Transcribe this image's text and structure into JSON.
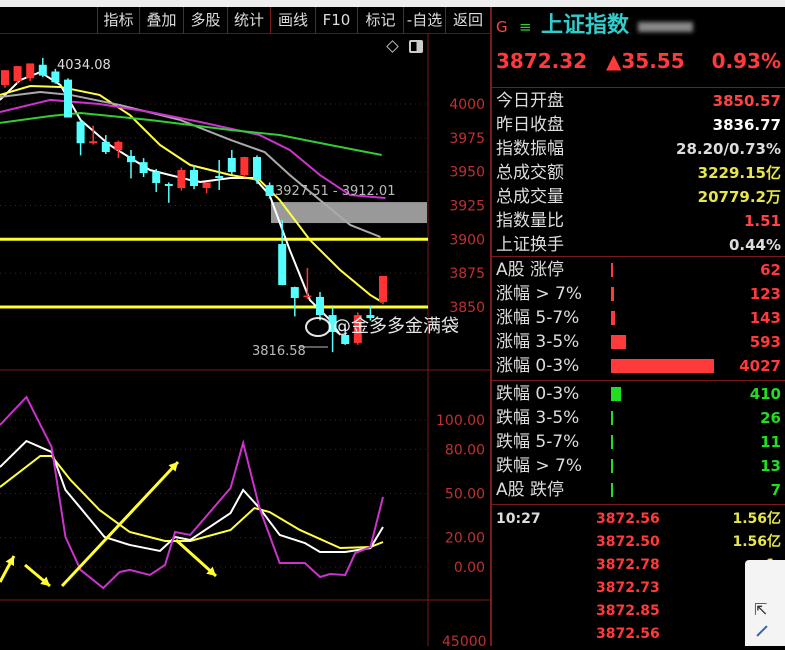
{
  "toolbar": {
    "items": [
      "指标",
      "叠加",
      "多股",
      "统计",
      "画线",
      "F10",
      "标记",
      "-自选",
      "返回"
    ]
  },
  "chart": {
    "price_axis": [
      "4000",
      "3975",
      "3950",
      "3925",
      "3900",
      "3875",
      "3850"
    ],
    "price_axis_values": [
      4000,
      3975,
      3950,
      3925,
      3900,
      3875,
      3850
    ],
    "indicator_axis": [
      "100.00",
      "80.00",
      "50.00",
      "20.00",
      "0.00"
    ],
    "indicator_axis_values": [
      100,
      80,
      50,
      20,
      0
    ],
    "bottom_axis_label": "45000",
    "high_label": "4034.08",
    "low_label": "3816.58",
    "range_label": "3927.51 - 3912.01",
    "range_band": [
      3912.01,
      3927.51
    ],
    "support_lines": [
      3900,
      3850
    ],
    "watermark": "@金多多金满袋",
    "colors": {
      "up": "#ff3333",
      "down": "#55ffff",
      "ma5": "#ffffff",
      "ma10": "#ffff44",
      "ma20": "#aaaaaa",
      "ma30": "#cc33cc",
      "ma60": "#33cc33",
      "k": "#ffffff",
      "d": "#ffff44",
      "j": "#cc33cc"
    }
  },
  "chart_data": {
    "type": "candlestick",
    "ylim": [
      3810,
      4040
    ],
    "candles": [
      {
        "o": 4014,
        "h": 4025,
        "l": 4012,
        "c": 4025
      },
      {
        "o": 4017,
        "h": 4028,
        "l": 4015,
        "c": 4028
      },
      {
        "o": 4019,
        "h": 4030,
        "l": 4017,
        "c": 4030
      },
      {
        "o": 4029,
        "h": 4034.08,
        "l": 4020,
        "c": 4021
      },
      {
        "o": 4024,
        "h": 4026,
        "l": 4015,
        "c": 4016
      },
      {
        "o": 4018,
        "h": 4019,
        "l": 3990,
        "c": 3990
      },
      {
        "o": 3987,
        "h": 3988,
        "l": 3962,
        "c": 3971
      },
      {
        "o": 3971,
        "h": 3984,
        "l": 3970,
        "c": 3972.5
      },
      {
        "o": 3972,
        "h": 3977,
        "l": 3963,
        "c": 3964.5
      },
      {
        "o": 3966,
        "h": 3973,
        "l": 3960,
        "c": 3972
      },
      {
        "o": 3961.6,
        "h": 3966,
        "l": 3945,
        "c": 3957
      },
      {
        "o": 3957,
        "h": 3960,
        "l": 3946,
        "c": 3949
      },
      {
        "o": 3949.7,
        "h": 3952,
        "l": 3935,
        "c": 3941.6
      },
      {
        "o": 3940.9,
        "h": 3942,
        "l": 3927,
        "c": 3939.4
      },
      {
        "o": 3937.9,
        "h": 3953,
        "l": 3936,
        "c": 3951.2
      },
      {
        "o": 3951.2,
        "h": 3955,
        "l": 3937,
        "c": 3939.4
      },
      {
        "o": 3937.9,
        "h": 3942,
        "l": 3934,
        "c": 3942
      },
      {
        "o": 3946.8,
        "h": 3958.6,
        "l": 3936.4,
        "c": 3945.3
      },
      {
        "o": 3960.1,
        "h": 3966,
        "l": 3948,
        "c": 3949.7
      },
      {
        "o": 3947.5,
        "h": 3961,
        "l": 3946,
        "c": 3960.8
      },
      {
        "o": 3960.8,
        "h": 3962,
        "l": 3941,
        "c": 3943.8
      },
      {
        "o": 3940,
        "h": 3942,
        "l": 3930,
        "c": 3932
      },
      {
        "o": 3896.5,
        "h": 3914.3,
        "l": 3866,
        "c": 3866.2
      },
      {
        "o": 3864.7,
        "h": 3865,
        "l": 3843,
        "c": 3856.6
      },
      {
        "o": 3857.4,
        "h": 3878.8,
        "l": 3856,
        "c": 3858.4
      },
      {
        "o": 3857.4,
        "h": 3861,
        "l": 3840,
        "c": 3844
      },
      {
        "o": 3844,
        "h": 3850,
        "l": 3816.58,
        "c": 3831.5
      },
      {
        "o": 3829.3,
        "h": 3834,
        "l": 3822,
        "c": 3822.6
      },
      {
        "o": 3823.4,
        "h": 3846,
        "l": 3822,
        "c": 3844
      },
      {
        "o": 3844,
        "h": 3851,
        "l": 3840,
        "c": 3841.8
      },
      {
        "o": 3853.7,
        "h": 3873,
        "l": 3852,
        "c": 3872.9
      }
    ],
    "ma": [
      {
        "name": "MA5",
        "color": "ma5",
        "points": [
          [
            -0.4,
            4003
          ],
          [
            1.2,
            4017.7
          ],
          [
            2.8,
            4023.6
          ],
          [
            4.4,
            4014
          ],
          [
            6,
            3988.2
          ],
          [
            8.3,
            3969.7
          ],
          [
            11.5,
            3951.2
          ],
          [
            14.7,
            3943.8
          ],
          [
            15.5,
            3942.4
          ],
          [
            17.9,
            3945.3
          ],
          [
            19.8,
            3945.3
          ],
          [
            21,
            3932.7
          ],
          [
            22.6,
            3892.1
          ],
          [
            24.2,
            3855.1
          ],
          [
            25.8,
            3840.3
          ],
          [
            26.6,
            3829.3
          ]
        ]
      },
      {
        "name": "MA10",
        "color": "ma10",
        "points": [
          [
            -0.4,
            4006.7
          ],
          [
            2,
            4013.3
          ],
          [
            4.4,
            4012.6
          ],
          [
            7.5,
            4006.7
          ],
          [
            9.9,
            3991.9
          ],
          [
            12.3,
            3969.7
          ],
          [
            14.7,
            3954.9
          ],
          [
            17.9,
            3947.5
          ],
          [
            20.2,
            3943.8
          ],
          [
            21.8,
            3929
          ],
          [
            24.2,
            3899.5
          ],
          [
            26.6,
            3877.3
          ],
          [
            29,
            3858.8
          ],
          [
            29.9,
            3853.7
          ]
        ]
      },
      {
        "name": "MA20",
        "color": "ma20",
        "points": [
          [
            -0.4,
            4005.2
          ],
          [
            2.8,
            4008.9
          ],
          [
            5.2,
            4006.7
          ],
          [
            9.1,
            3999.3
          ],
          [
            13.9,
            3988.2
          ],
          [
            17.9,
            3973.4
          ],
          [
            20.6,
            3964.5
          ],
          [
            22.6,
            3947.5
          ],
          [
            25,
            3929
          ],
          [
            27.4,
            3910.6
          ],
          [
            29.8,
            3901.7
          ]
        ]
      },
      {
        "name": "MA30",
        "color": "ma30",
        "points": [
          [
            -0.4,
            3994.1
          ],
          [
            3.6,
            4003
          ],
          [
            7.5,
            4000
          ],
          [
            11.5,
            3994.1
          ],
          [
            15.5,
            3986.7
          ],
          [
            20.2,
            3977.1
          ],
          [
            22.6,
            3966
          ],
          [
            25,
            3947.5
          ],
          [
            27.4,
            3932.7
          ],
          [
            30.2,
            3930.5
          ]
        ]
      },
      {
        "name": "MA60",
        "color": "ma60",
        "points": [
          [
            -0.4,
            3986
          ],
          [
            3.6,
            3991.1
          ],
          [
            6,
            3993.3
          ],
          [
            11.5,
            3988.2
          ],
          [
            17.9,
            3980.8
          ],
          [
            21.8,
            3977.1
          ],
          [
            25.8,
            3969.7
          ],
          [
            29.9,
            3962.3
          ]
        ]
      }
    ],
    "kdj": {
      "ylim": [
        -20,
        120
      ],
      "J": [
        [
          -0.4,
          96.6
        ],
        [
          1.7,
          115.6
        ],
        [
          3.7,
          81.6
        ],
        [
          4.8,
          20.4
        ],
        [
          6,
          -2
        ],
        [
          7.8,
          -14.3
        ],
        [
          9.1,
          -3.4
        ],
        [
          9.9,
          -2
        ],
        [
          11.5,
          -5.4
        ],
        [
          12.7,
          1.4
        ],
        [
          13.5,
          23.8
        ],
        [
          14.7,
          21.8
        ],
        [
          17.9,
          53.7
        ],
        [
          18.9,
          84.4
        ],
        [
          20.2,
          40.1
        ],
        [
          21.8,
          2.7
        ],
        [
          23.8,
          2.7
        ],
        [
          25,
          -6.8
        ],
        [
          25.8,
          -4.8
        ],
        [
          27,
          -5.4
        ],
        [
          27.8,
          9.5
        ],
        [
          29,
          13.6
        ],
        [
          30,
          47.6
        ]
      ],
      "K": [
        [
          -0.4,
          68
        ],
        [
          1.7,
          85.7
        ],
        [
          3.7,
          78.2
        ],
        [
          4.8,
          52.4
        ],
        [
          6,
          40.1
        ],
        [
          7.9,
          20.4
        ],
        [
          9.9,
          15
        ],
        [
          12.3,
          10.9
        ],
        [
          13.5,
          20.4
        ],
        [
          14.7,
          18.4
        ],
        [
          17.9,
          36.7
        ],
        [
          18.9,
          52.4
        ],
        [
          20.2,
          40.1
        ],
        [
          21.8,
          21.8
        ],
        [
          23.8,
          16.3
        ],
        [
          25,
          10.2
        ],
        [
          27,
          10.2
        ],
        [
          29,
          12.9
        ],
        [
          30,
          27.2
        ]
      ],
      "D": [
        [
          -0.4,
          54.4
        ],
        [
          2.8,
          75.5
        ],
        [
          3.7,
          75.5
        ],
        [
          5.2,
          59.2
        ],
        [
          7.5,
          38.8
        ],
        [
          9.9,
          23.8
        ],
        [
          12.7,
          17.7
        ],
        [
          14.7,
          17.7
        ],
        [
          17.9,
          25.2
        ],
        [
          19.8,
          40.1
        ],
        [
          21,
          37.4
        ],
        [
          23.4,
          25.2
        ],
        [
          26.6,
          12.9
        ],
        [
          29,
          13.6
        ],
        [
          30,
          17
        ]
      ]
    }
  },
  "quote": {
    "flag": "G",
    "menu_icon": "≡",
    "name": "上证指数",
    "price": "3872.32",
    "change": "▲35.55",
    "pct": "0.93%"
  },
  "stats": [
    {
      "label": "今日开盘",
      "value": "3850.57",
      "color": "#ff4444"
    },
    {
      "label": "昨日收盘",
      "value": "3836.77",
      "color": "#ffffff"
    },
    {
      "label": "指数振幅",
      "value": "28.20/0.73%",
      "color": "#dddddd"
    },
    {
      "label": "总成交额",
      "value": "3229.15亿",
      "color": "#e6e64a"
    },
    {
      "label": "总成交量",
      "value": "20779.2万",
      "color": "#e6e64a"
    },
    {
      "label": "指数量比",
      "value": "1.51",
      "color": "#ff4444"
    },
    {
      "label": "上证换手",
      "value": "0.44%",
      "color": "#dddddd"
    }
  ],
  "breadth_max": 4027,
  "up_rows": [
    {
      "label": "A股 涨停",
      "value": 62
    },
    {
      "label": "涨幅 > 7%",
      "value": 123
    },
    {
      "label": "涨幅 5-7%",
      "value": 143
    },
    {
      "label": "涨幅 3-5%",
      "value": 593
    },
    {
      "label": "涨幅 0-3%",
      "value": 4027
    }
  ],
  "down_rows": [
    {
      "label": "跌幅 0-3%",
      "value": 410
    },
    {
      "label": "跌幅 3-5%",
      "value": 26
    },
    {
      "label": "跌幅 5-7%",
      "value": 11
    },
    {
      "label": "跌幅 > 7%",
      "value": 13
    },
    {
      "label": "A股 跌停",
      "value": 7
    }
  ],
  "ticks": [
    {
      "time": "10:27",
      "price": "3872.56",
      "vol": "1.56亿"
    },
    {
      "time": "",
      "price": "3872.50",
      "vol": "1.56亿"
    },
    {
      "time": "",
      "price": "3872.78",
      "vol": "1."
    },
    {
      "time": "",
      "price": "3872.73",
      "vol": "1."
    },
    {
      "time": "",
      "price": "3872.85",
      "vol": "1."
    },
    {
      "time": "",
      "price": "3872.56",
      "vol": "1."
    }
  ]
}
